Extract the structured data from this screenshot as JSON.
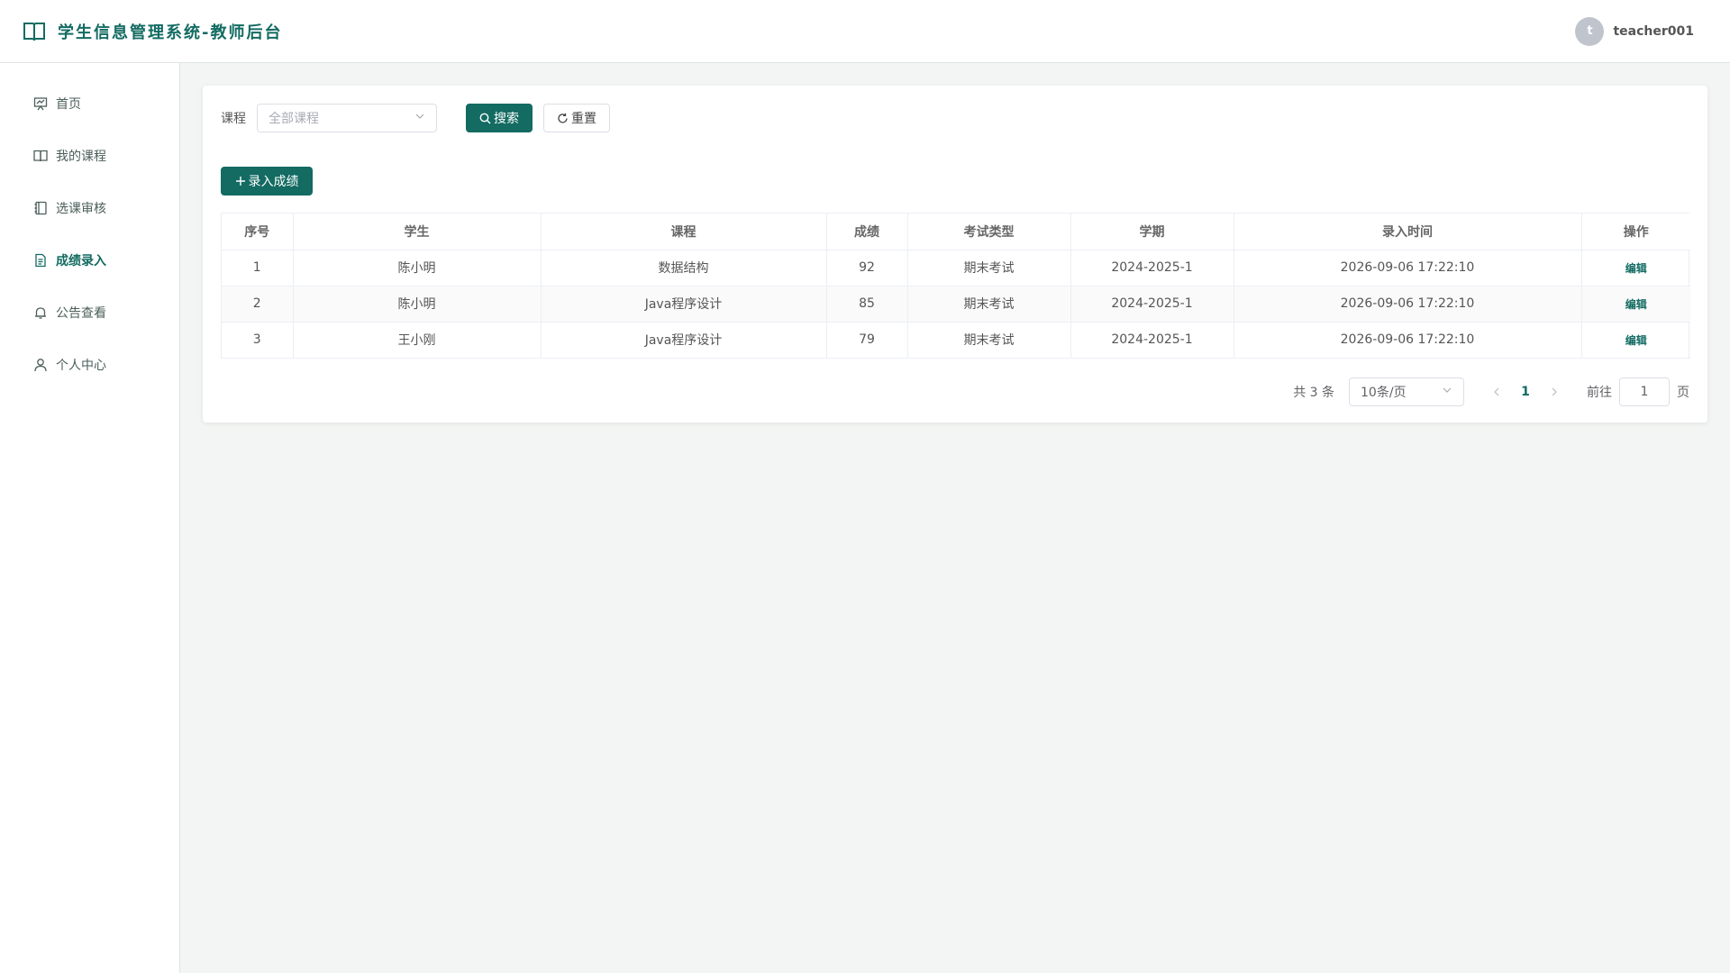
{
  "header": {
    "title": "学生信息管理系统-教师后台",
    "avatar_letter": "t",
    "username": "teacher001"
  },
  "sidebar": {
    "items": [
      {
        "label": "首页",
        "icon": "presentation-chart-icon"
      },
      {
        "label": "我的课程",
        "icon": "book-icon"
      },
      {
        "label": "选课审核",
        "icon": "notebook-icon"
      },
      {
        "label": "成绩录入",
        "icon": "document-icon",
        "active": true
      },
      {
        "label": "公告查看",
        "icon": "bell-icon"
      },
      {
        "label": "个人中心",
        "icon": "user-icon"
      }
    ]
  },
  "filter": {
    "course_label": "课程",
    "course_placeholder": "全部课程",
    "search_label": "搜索",
    "reset_label": "重置"
  },
  "toolbar": {
    "add_label": "录入成绩"
  },
  "table": {
    "columns": [
      "序号",
      "学生",
      "课程",
      "成绩",
      "考试类型",
      "学期",
      "录入时间",
      "操作"
    ],
    "rows": [
      {
        "index": "1",
        "student": "陈小明",
        "course": "数据结构",
        "score": "92",
        "exam_type": "期末考试",
        "term": "2024-2025-1",
        "time": "2026-09-06 17:22:10",
        "action": "编辑"
      },
      {
        "index": "2",
        "student": "陈小明",
        "course": "Java程序设计",
        "score": "85",
        "exam_type": "期末考试",
        "term": "2024-2025-1",
        "time": "2026-09-06 17:22:10",
        "action": "编辑"
      },
      {
        "index": "3",
        "student": "王小刚",
        "course": "Java程序设计",
        "score": "79",
        "exam_type": "期末考试",
        "term": "2024-2025-1",
        "time": "2026-09-06 17:22:10",
        "action": "编辑"
      }
    ]
  },
  "pagination": {
    "total": "共 3 条",
    "page_size": "10条/页",
    "current_page": "1",
    "goto_label": "前往",
    "goto_value": "1",
    "page_unit": "页"
  },
  "colors": {
    "primary": "#136b62",
    "background": "#f3f5f4"
  }
}
